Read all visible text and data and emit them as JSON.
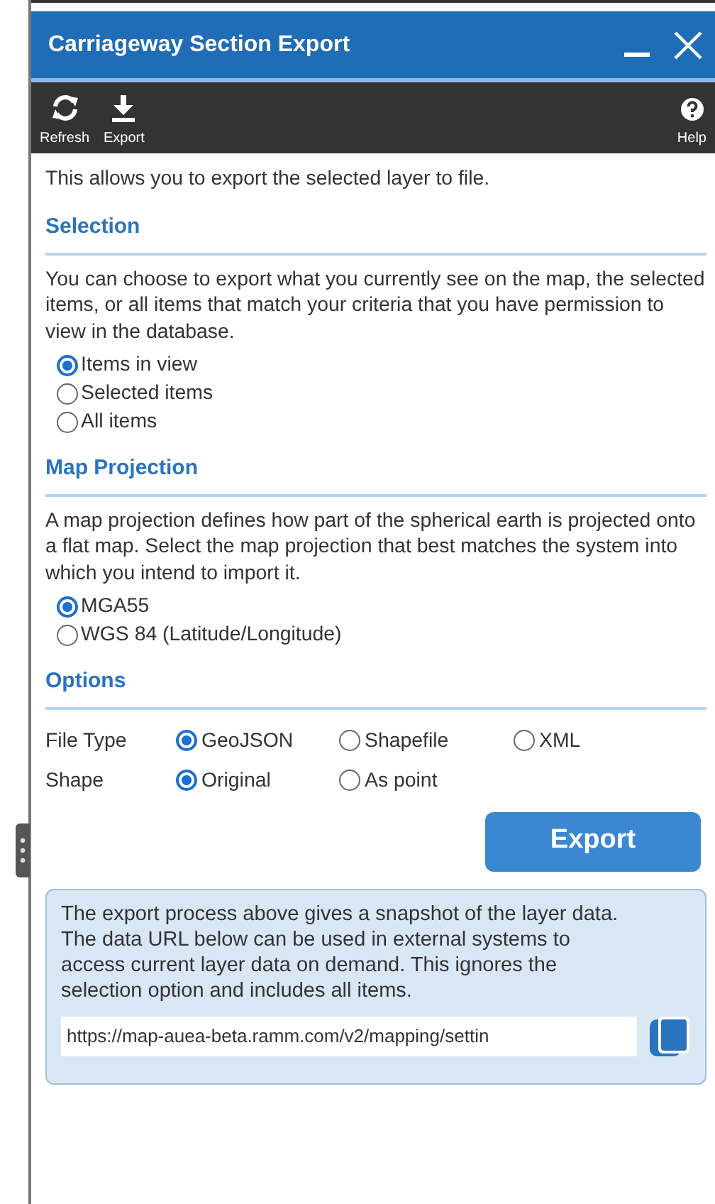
{
  "window": {
    "title": "Carriageway Section Export",
    "controls": [
      {
        "kind": "minimize"
      },
      {
        "kind": "close"
      }
    ]
  },
  "toolbar": [
    {
      "kind": "refresh",
      "label": "Refresh"
    },
    {
      "kind": "export",
      "label": "Export"
    },
    {
      "kind": "help",
      "label": "Help"
    }
  ],
  "intro": "This allows you to export the selected layer to file.",
  "sections": [
    {
      "heading": "Selection",
      "text": "You can choose to export what you currently see on the map, the selected items, or all items that match your criteria that you have permission to view in the database.",
      "options": [
        {
          "label": "Items in view",
          "selected": true
        },
        {
          "label": "Selected items",
          "selected": false
        },
        {
          "label": "All items",
          "selected": false
        }
      ]
    },
    {
      "heading": "Map Projection",
      "text": "A map projection defines how part of the spherical earth is projected onto a flat map. Select the map projection that best matches the system into which you intend to import it.",
      "options": [
        {
          "label": "MGA55",
          "selected": true
        },
        {
          "label": "WGS 84 (Latitude/Longitude)",
          "selected": false
        }
      ]
    }
  ],
  "options": {
    "heading": "Options",
    "rows": [
      {
        "label": "File Type",
        "choices": [
          {
            "label": "GeoJSON",
            "selected": true
          },
          {
            "label": "Shapefile",
            "selected": false
          },
          {
            "label": "XML",
            "selected": false
          }
        ]
      },
      {
        "label": "Shape",
        "choices": [
          {
            "label": "Original",
            "selected": true
          },
          {
            "label": "As point",
            "selected": false
          }
        ]
      }
    ]
  },
  "export_button": "Export",
  "info": {
    "text": "The export process above gives a snapshot of the layer data. The data URL below can be used in external systems to access current layer data on demand. This ignores the selection option and includes all items.",
    "url": "https://map-auea-beta.ramm.com/v2/mapping/settin"
  }
}
